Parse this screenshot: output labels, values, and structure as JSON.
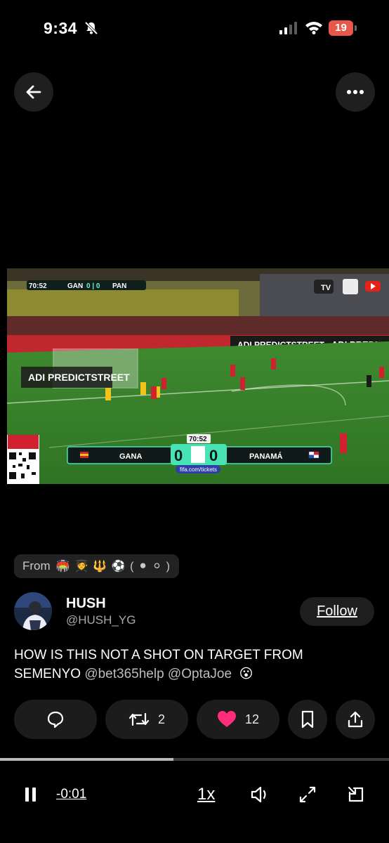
{
  "status_bar": {
    "time": "9:34",
    "battery": "19",
    "icons": [
      "bell-slash-icon",
      "signal-icon",
      "wifi-icon",
      "battery-icon"
    ]
  },
  "header": {
    "back_icon": "arrow-left-icon",
    "more_icon": "ellipsis-icon"
  },
  "video": {
    "clock": "70:52",
    "home_team_short": "GAN",
    "away_team_short": "PAN",
    "home_team": "GANA",
    "away_team": "PANAMÁ",
    "home_score": "0",
    "away_score": "0",
    "score_small": "0 | 0",
    "sponsor_board": "ADI PREDICTSTREET",
    "sponsor_board_2": "ADI PREDI",
    "url": "fifa.com/tickets",
    "channel_label": "TV"
  },
  "from_chip": {
    "label": "From",
    "emojis": "🏟️ 🧑‍🎓 🔱 ⚽ ( ⚫ ⚪ )"
  },
  "author": {
    "name": "HUSH",
    "handle": "@HUSH_YG",
    "follow_label": "Follow"
  },
  "tweet": {
    "text_main": "HOW IS THIS NOT A SHOT ON TARGET FROM SEMENYO ",
    "mention_1": "@bet365help",
    "mention_2": "@OptaJoe",
    "emoji": "😮"
  },
  "actions": {
    "reply_icon": "reply-bubble-icon",
    "retweet_count": "2",
    "like_count": "12",
    "bookmark_icon": "bookmark-icon",
    "share_icon": "share-icon",
    "like_color": "#ff2d7a"
  },
  "player": {
    "progress": 0.445,
    "time_remaining": "-0:01",
    "speed": "1x"
  }
}
